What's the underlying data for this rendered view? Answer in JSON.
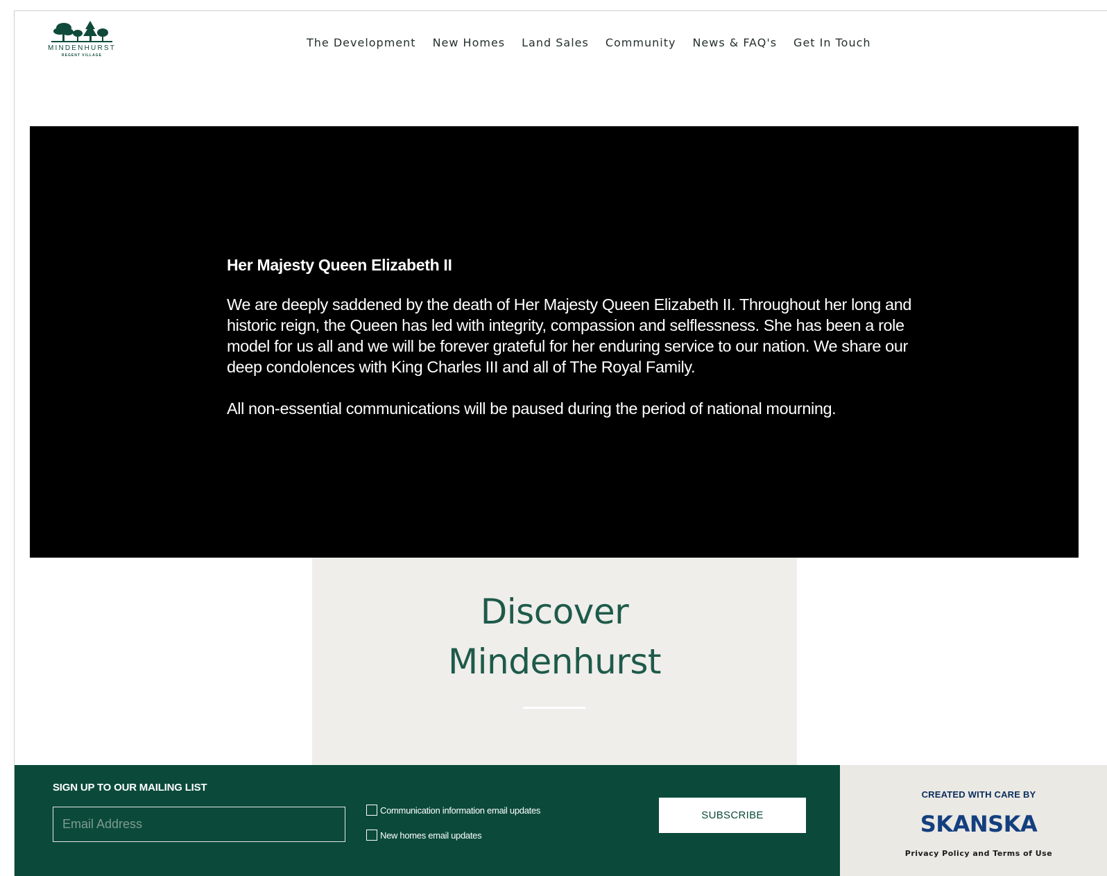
{
  "header": {
    "logo": {
      "name": "MINDENHURST",
      "tagline": "REGENT VILLAGE",
      "icon": "tree-group-icon"
    },
    "nav": [
      {
        "label": "The Development"
      },
      {
        "label": "New Homes"
      },
      {
        "label": "Land Sales"
      },
      {
        "label": "Community"
      },
      {
        "label": "News & FAQ's"
      },
      {
        "label": "Get In Touch"
      }
    ]
  },
  "announcement": {
    "title": "Her Majesty Queen Elizabeth II",
    "body": "We are deeply saddened by the death of Her Majesty Queen Elizabeth II. Throughout her long and historic reign, the Queen has led with integrity, compassion and selflessness. She has been a role model for us all and we will be forever grateful for her enduring service to our nation. We share our deep condolences with King Charles III and all of The Royal Family.",
    "note": "All non-essential communications will be paused during the period of national mourning."
  },
  "discover": {
    "line1": "Discover",
    "line2": "Mindenhurst"
  },
  "footer": {
    "signup": {
      "heading": "SIGN UP TO OUR MAILING LIST",
      "email_placeholder": "Email Address",
      "email_value": "",
      "checkboxes": [
        {
          "label": "Communication information email updates",
          "checked": false
        },
        {
          "label": "New homes email updates",
          "checked": false
        }
      ],
      "subscribe_label": "SUBSCRIBE"
    },
    "credit": {
      "label": "CREATED WITH CARE BY",
      "brand": "SKANSKA",
      "privacy_label": "Privacy Policy and Terms of Use"
    }
  },
  "colors": {
    "brand_green": "#0b4a3a",
    "discover_text": "#1e5a4a",
    "discover_bg": "#efeeeb",
    "credit_bg": "#ebe9e4",
    "skanska_blue": "#143f7f",
    "announcement_bg": "#000000"
  }
}
